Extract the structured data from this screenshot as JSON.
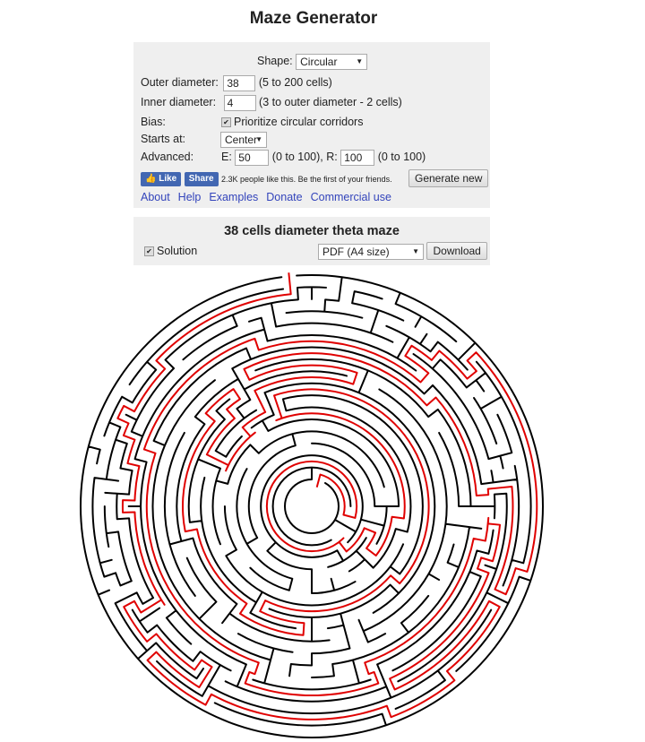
{
  "title": "Maze Generator",
  "form": {
    "shape_label": "Shape:",
    "shape_value": "Circular",
    "outer_label": "Outer diameter:",
    "outer_value": "38",
    "outer_hint": "(5 to 200 cells)",
    "inner_label": "Inner diameter:",
    "inner_value": "4",
    "inner_hint": "(3 to outer diameter - 2 cells)",
    "bias_label": "Bias:",
    "bias_checked": true,
    "bias_text": "Prioritize circular corridors",
    "starts_label": "Starts at:",
    "starts_value": "Center",
    "advanced_label": "Advanced:",
    "e_label": "E:",
    "e_value": "50",
    "e_hint": "(0 to 100), R:",
    "r_value": "100",
    "r_hint": "(0 to 100)",
    "like_label": "Like",
    "share_label": "Share",
    "social_text": "2.3K people like this. Be the first of your friends.",
    "generate_label": "Generate new"
  },
  "links": [
    "About",
    "Help",
    "Examples",
    "Donate",
    "Commercial use"
  ],
  "result": {
    "title": "38 cells diameter theta maze",
    "solution_label": "Solution",
    "solution_checked": true,
    "format_value": "PDF (A4 size)",
    "download_label": "Download"
  },
  "colors": {
    "wall": "#000000",
    "solution": "#e00000",
    "panel": "#efefef",
    "link": "#3344bb"
  }
}
